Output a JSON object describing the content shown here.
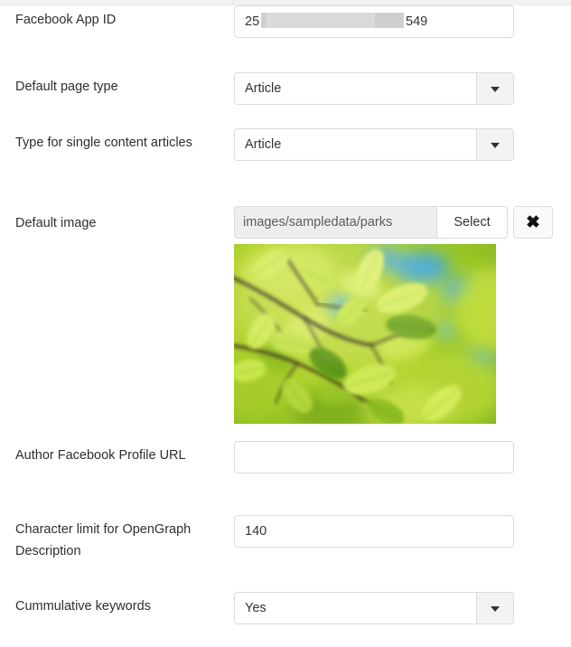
{
  "form": {
    "fields": [
      {
        "id": "facebook-app-id",
        "label": "Facebook App ID",
        "type": "text",
        "value_prefix": "25",
        "value_suffix": "549",
        "redacted": true,
        "placeholder": ""
      },
      {
        "id": "default-page-type",
        "label": "Default page type",
        "type": "select",
        "value": "Article"
      },
      {
        "id": "type-single-content-articles",
        "label": "Type for single content articles",
        "type": "select",
        "value": "Article"
      },
      {
        "id": "default-image",
        "label": "Default image",
        "type": "media",
        "value": "images/sampledata/parks",
        "select_label": "Select",
        "clear_label": "✖",
        "preview_alt": "Green backlit beech leaves against blue sky"
      },
      {
        "id": "author-facebook-profile-url",
        "label": "Author Facebook Profile URL",
        "type": "text",
        "value": "",
        "placeholder": ""
      },
      {
        "id": "character-limit-opengraph-description",
        "label": "Character limit for OpenGraph Description",
        "type": "text",
        "value": "140",
        "placeholder": ""
      },
      {
        "id": "cummulative-keywords",
        "label": "Cummulative keywords",
        "type": "select",
        "value": "Yes"
      }
    ]
  },
  "colors": {
    "page_background": "#ffffff",
    "label_text": "#2f2f2f",
    "input_border": "#dcdcdc",
    "input_text": "#333333",
    "select_button_background": "#f3f3f3",
    "media_input_background": "#eeeeee",
    "redaction_gray": "#cfcfcf",
    "top_strip": "#f2f2f2"
  },
  "icons": {
    "chevron_down": "caret-down-icon",
    "clear": "close-x-icon"
  }
}
